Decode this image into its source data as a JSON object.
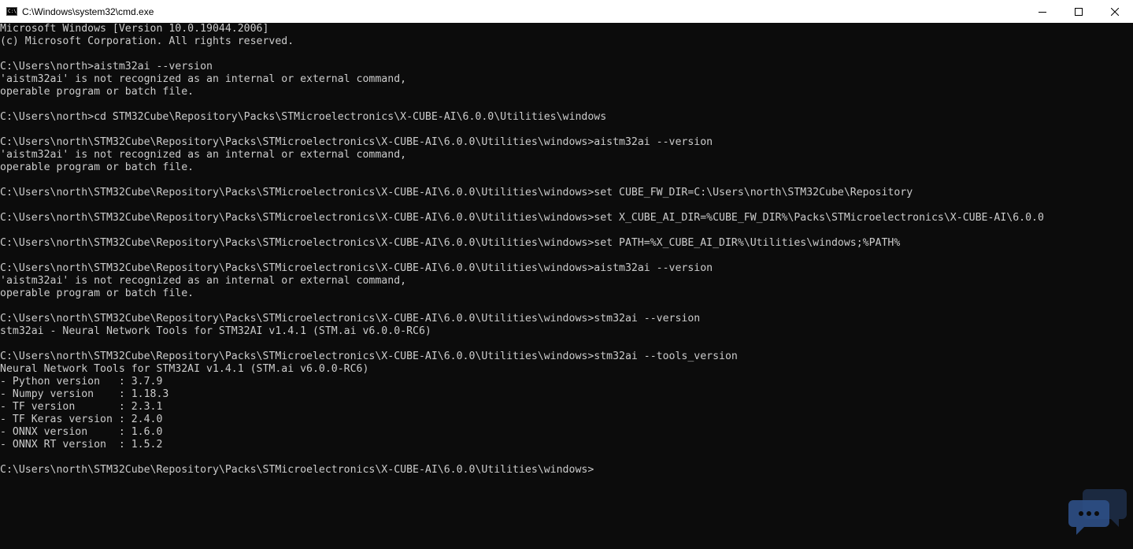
{
  "window": {
    "title": "C:\\Windows\\system32\\cmd.exe",
    "icon_name": "cmd-icon"
  },
  "controls": [
    "minimize-icon",
    "maximize-icon",
    "close-icon"
  ],
  "colors": {
    "background": "#0c0c0c",
    "foreground": "#cccccc",
    "titlebar": "#ffffff"
  },
  "console": {
    "lines": [
      "Microsoft Windows [Version 10.0.19044.2006]",
      "(c) Microsoft Corporation. All rights reserved.",
      "",
      "C:\\Users\\north>aistm32ai --version",
      "'aistm32ai' is not recognized as an internal or external command,",
      "operable program or batch file.",
      "",
      "C:\\Users\\north>cd STM32Cube\\Repository\\Packs\\STMicroelectronics\\X-CUBE-AI\\6.0.0\\Utilities\\windows",
      "",
      "C:\\Users\\north\\STM32Cube\\Repository\\Packs\\STMicroelectronics\\X-CUBE-AI\\6.0.0\\Utilities\\windows>aistm32ai --version",
      "'aistm32ai' is not recognized as an internal or external command,",
      "operable program or batch file.",
      "",
      "C:\\Users\\north\\STM32Cube\\Repository\\Packs\\STMicroelectronics\\X-CUBE-AI\\6.0.0\\Utilities\\windows>set CUBE_FW_DIR=C:\\Users\\north\\STM32Cube\\Repository",
      "",
      "C:\\Users\\north\\STM32Cube\\Repository\\Packs\\STMicroelectronics\\X-CUBE-AI\\6.0.0\\Utilities\\windows>set X_CUBE_AI_DIR=%CUBE_FW_DIR%\\Packs\\STMicroelectronics\\X-CUBE-AI\\6.0.0",
      "",
      "C:\\Users\\north\\STM32Cube\\Repository\\Packs\\STMicroelectronics\\X-CUBE-AI\\6.0.0\\Utilities\\windows>set PATH=%X_CUBE_AI_DIR%\\Utilities\\windows;%PATH%",
      "",
      "C:\\Users\\north\\STM32Cube\\Repository\\Packs\\STMicroelectronics\\X-CUBE-AI\\6.0.0\\Utilities\\windows>aistm32ai --version",
      "'aistm32ai' is not recognized as an internal or external command,",
      "operable program or batch file.",
      "",
      "C:\\Users\\north\\STM32Cube\\Repository\\Packs\\STMicroelectronics\\X-CUBE-AI\\6.0.0\\Utilities\\windows>stm32ai --version",
      "stm32ai - Neural Network Tools for STM32AI v1.4.1 (STM.ai v6.0.0-RC6)",
      "",
      "C:\\Users\\north\\STM32Cube\\Repository\\Packs\\STMicroelectronics\\X-CUBE-AI\\6.0.0\\Utilities\\windows>stm32ai --tools_version",
      "Neural Network Tools for STM32AI v1.4.1 (STM.ai v6.0.0-RC6)",
      "- Python version   : 3.7.9",
      "- Numpy version    : 1.18.3",
      "- TF version       : 2.3.1",
      "- TF Keras version : 2.4.0",
      "- ONNX version     : 1.6.0",
      "- ONNX RT version  : 1.5.2",
      "",
      "C:\\Users\\north\\STM32Cube\\Repository\\Packs\\STMicroelectronics\\X-CUBE-AI\\6.0.0\\Utilities\\windows>"
    ]
  }
}
